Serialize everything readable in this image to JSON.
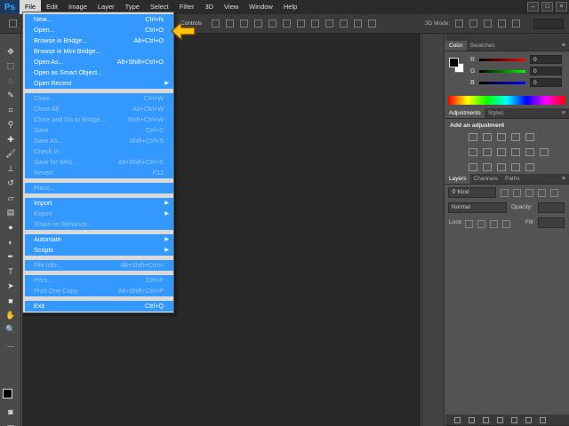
{
  "app": {
    "logo": "Ps"
  },
  "menubar": {
    "items": [
      "File",
      "Edit",
      "Image",
      "Layer",
      "Type",
      "Select",
      "Filter",
      "3D",
      "View",
      "Window",
      "Help"
    ],
    "window_controls": [
      "–",
      "□",
      "×"
    ]
  },
  "optbar": {
    "controls_label": "Controls",
    "mode_3d": "3D Mode:"
  },
  "file_menu": {
    "groups": [
      [
        {
          "label": "New...",
          "shortcut": "Ctrl+N",
          "enabled": true
        },
        {
          "label": "Open...",
          "shortcut": "Ctrl+O",
          "enabled": true
        },
        {
          "label": "Browse in Bridge...",
          "shortcut": "Alt+Ctrl+O",
          "enabled": true
        },
        {
          "label": "Browse in Mini Bridge...",
          "shortcut": "",
          "enabled": true
        },
        {
          "label": "Open As...",
          "shortcut": "Alt+Shift+Ctrl+O",
          "enabled": true
        },
        {
          "label": "Open as Smart Object...",
          "shortcut": "",
          "enabled": true
        },
        {
          "label": "Open Recent",
          "shortcut": "",
          "submenu": true,
          "enabled": true
        }
      ],
      [
        {
          "label": "Close",
          "shortcut": "Ctrl+W",
          "enabled": false
        },
        {
          "label": "Close All",
          "shortcut": "Alt+Ctrl+W",
          "enabled": false
        },
        {
          "label": "Close and Go to Bridge...",
          "shortcut": "Shift+Ctrl+W",
          "enabled": false
        },
        {
          "label": "Save",
          "shortcut": "Ctrl+S",
          "enabled": false
        },
        {
          "label": "Save As...",
          "shortcut": "Shift+Ctrl+S",
          "enabled": false
        },
        {
          "label": "Check In...",
          "shortcut": "",
          "enabled": false
        },
        {
          "label": "Save for Web...",
          "shortcut": "Alt+Shift+Ctrl+S",
          "enabled": false
        },
        {
          "label": "Revert",
          "shortcut": "F12",
          "enabled": false
        }
      ],
      [
        {
          "label": "Place...",
          "shortcut": "",
          "enabled": false
        }
      ],
      [
        {
          "label": "Import",
          "shortcut": "",
          "submenu": true,
          "enabled": true
        },
        {
          "label": "Export",
          "shortcut": "",
          "submenu": true,
          "enabled": false
        },
        {
          "label": "Share on Behance...",
          "shortcut": "",
          "enabled": false
        }
      ],
      [
        {
          "label": "Automate",
          "shortcut": "",
          "submenu": true,
          "enabled": true
        },
        {
          "label": "Scripts",
          "shortcut": "",
          "submenu": true,
          "enabled": true
        }
      ],
      [
        {
          "label": "File Info...",
          "shortcut": "Alt+Shift+Ctrl+I",
          "enabled": false
        }
      ],
      [
        {
          "label": "Print...",
          "shortcut": "Ctrl+P",
          "enabled": false
        },
        {
          "label": "Print One Copy",
          "shortcut": "Alt+Shift+Ctrl+P",
          "enabled": false
        }
      ],
      [
        {
          "label": "Exit",
          "shortcut": "Ctrl+Q",
          "enabled": true
        }
      ]
    ]
  },
  "color_panel": {
    "tabs": [
      "Color",
      "Swatches"
    ],
    "channels": [
      {
        "name": "R",
        "value": "0",
        "gradient": "#ff0000"
      },
      {
        "name": "G",
        "value": "0",
        "gradient": "#00ff00"
      },
      {
        "name": "B",
        "value": "0",
        "gradient": "#0000ff"
      }
    ]
  },
  "adjustments_panel": {
    "tabs": [
      "Adjustments",
      "Styles"
    ],
    "title": "Add an adjustment"
  },
  "layers_panel": {
    "tabs": [
      "Layers",
      "Channels",
      "Paths"
    ],
    "filter": "Kind",
    "blend_mode": "Normal",
    "opacity_label": "Opacity:",
    "lock_label": "Lock:",
    "fill_label": "Fill:"
  },
  "colors": {
    "menu_highlight": "#3399ff",
    "pointer": "#ffc20e",
    "canvas": "#282828"
  }
}
